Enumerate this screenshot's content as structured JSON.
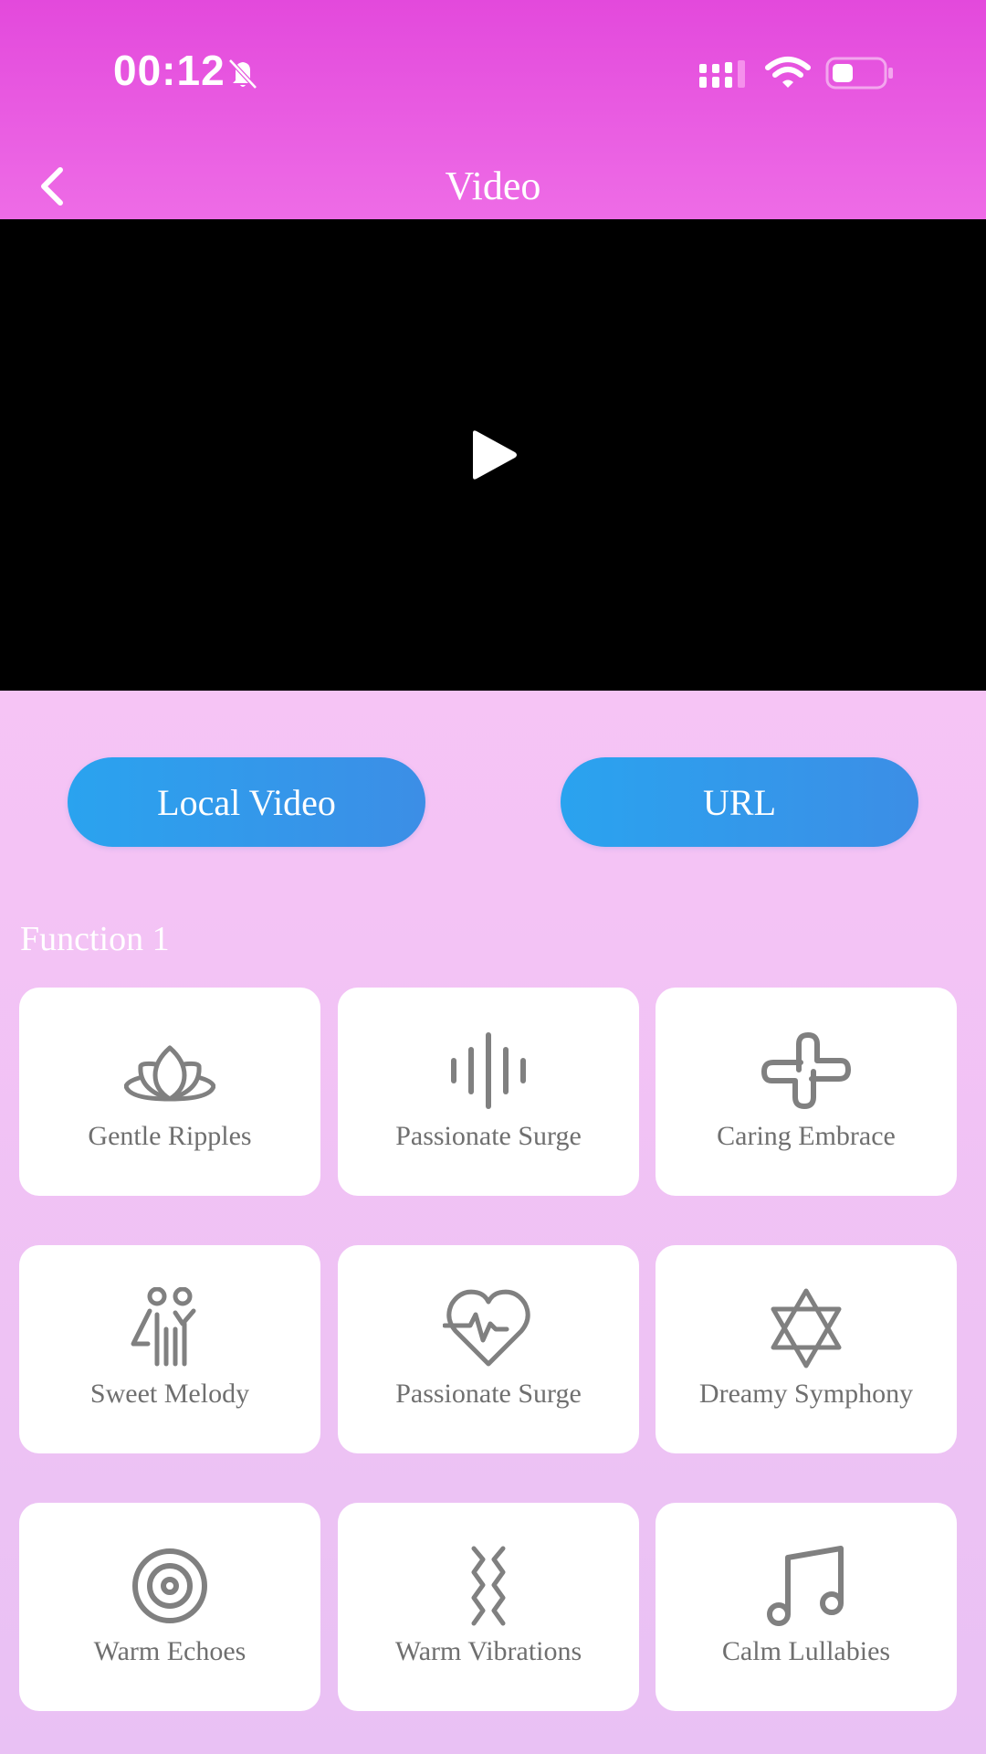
{
  "status_bar": {
    "time": "00:12"
  },
  "header": {
    "title": "Video"
  },
  "video": {
    "play_icon": "play-icon"
  },
  "buttons": {
    "local_video": "Local Video",
    "url": "URL"
  },
  "section": {
    "title": "Function 1"
  },
  "functions": [
    {
      "label": "Gentle Ripples",
      "icon": "lotus-icon"
    },
    {
      "label": "Passionate Surge",
      "icon": "sound-wave-icon"
    },
    {
      "label": "Caring Embrace",
      "icon": "knot-icon"
    },
    {
      "label": "Sweet Melody",
      "icon": "couple-icon"
    },
    {
      "label": "Passionate Surge",
      "icon": "heartbeat-icon"
    },
    {
      "label": "Dreamy Symphony",
      "icon": "star-of-david-icon"
    },
    {
      "label": "Warm Echoes",
      "icon": "target-icon"
    },
    {
      "label": "Warm Vibrations",
      "icon": "zigzag-waves-icon"
    },
    {
      "label": "Calm Lullabies",
      "icon": "music-note-icon"
    }
  ],
  "colors": {
    "header": "#e349dc",
    "button": "#2aa3ef",
    "icon": "#808080"
  }
}
